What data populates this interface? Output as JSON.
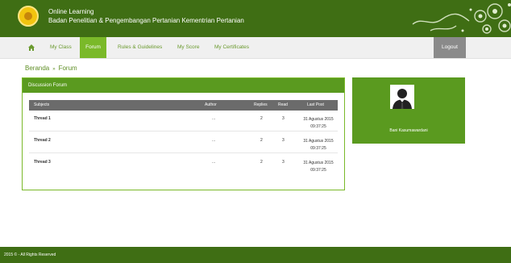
{
  "header": {
    "title": "Online Learning",
    "subtitle": "Badan Penelitian & Pengembangan Pertanian Kementrian Pertanian",
    "logo_icon": "ministry-logo",
    "decoration": "floral-ornament"
  },
  "nav": {
    "home_icon": "home-icon",
    "items": [
      {
        "label": "My Class"
      },
      {
        "label": "Forum"
      },
      {
        "label": "Rules & Guidelines"
      },
      {
        "label": "My Score"
      },
      {
        "label": "My Certificates"
      }
    ],
    "active": "Forum",
    "logout_label": "Logout"
  },
  "breadcrumb": {
    "home": "Beranda",
    "separator": "»",
    "current": "Forum"
  },
  "forum": {
    "title": "Discussion Forum",
    "columns": [
      "Subjects",
      "Author",
      "Replies",
      "Read",
      "Last Post"
    ],
    "threads": [
      {
        "subject": "Thread 1",
        "author": "...",
        "replies": "2",
        "read": "3",
        "last_post_date": "31 Agustus 2015",
        "last_post_time": "09:37:25"
      },
      {
        "subject": "Thread 2",
        "author": "...",
        "replies": "2",
        "read": "3",
        "last_post_date": "31 Agustus 2015",
        "last_post_time": "09:37:25"
      },
      {
        "subject": "Thread 3",
        "author": "...",
        "replies": "2",
        "read": "3",
        "last_post_date": "31 Agustus 2015",
        "last_post_time": "09:37:25"
      }
    ]
  },
  "profile": {
    "name": "Bani Kasumawardani",
    "avatar_icon": "user-silhouette-icon"
  },
  "footer": {
    "text": "2015 © - All Rights Reserved"
  },
  "colors": {
    "header_bg": "#3f6e14",
    "accent": "#7ab929",
    "panel_head": "#5a9a1f",
    "table_head": "#6b6b6b",
    "logout_bg": "#8a8a8a"
  }
}
